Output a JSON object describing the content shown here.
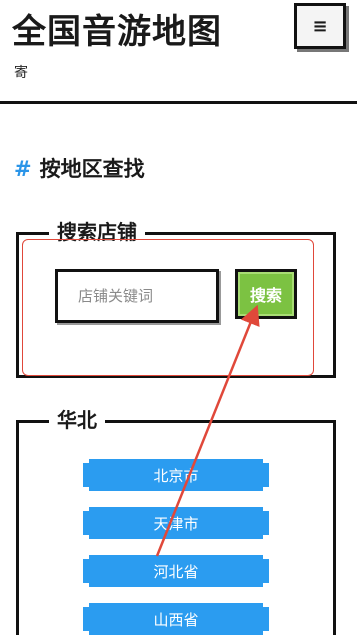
{
  "header": {
    "title": "全国音游地图",
    "subtitle": "寄",
    "menu_icon": "≡"
  },
  "section": {
    "hash": "#",
    "heading": "按地区查找"
  },
  "search": {
    "legend": "搜索店铺",
    "placeholder": "店铺关键词",
    "value": "",
    "button_label": "搜索",
    "button_color": "#7cc242"
  },
  "region_group": {
    "legend": "华北",
    "items": [
      {
        "label": "北京市"
      },
      {
        "label": "天津市"
      },
      {
        "label": "河北省"
      },
      {
        "label": "山西省"
      }
    ],
    "item_color": "#2b9cf0"
  },
  "annotation": {
    "color": "#e0483a"
  }
}
